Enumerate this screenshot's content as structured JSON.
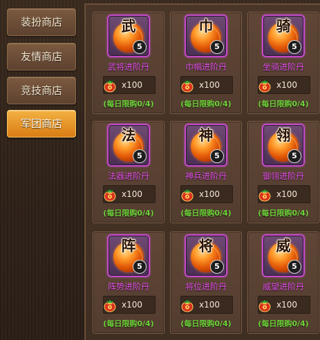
{
  "tabs": [
    {
      "label": "装扮商店",
      "active": false
    },
    {
      "label": "友情商店",
      "active": false
    },
    {
      "label": "竞技商店",
      "active": false
    },
    {
      "label": "军团商店",
      "active": true
    }
  ],
  "items": [
    {
      "glyph": "武",
      "name": "武将进阶丹",
      "count": "5",
      "price": "x100",
      "limit": "(每日限购0/4)"
    },
    {
      "glyph": "巾",
      "name": "巾帼进阶丹",
      "count": "5",
      "price": "x100",
      "limit": "(每日限购0/4)"
    },
    {
      "glyph": "骑",
      "name": "坐骑进阶丹",
      "count": "5",
      "price": "x100",
      "limit": "(每日限购0/4)"
    },
    {
      "glyph": "法",
      "name": "法器进阶丹",
      "count": "5",
      "price": "x100",
      "limit": "(每日限购0/4)"
    },
    {
      "glyph": "神",
      "name": "神兵进阶丹",
      "count": "5",
      "price": "x100",
      "limit": "(每日限购0/4)"
    },
    {
      "glyph": "翎",
      "name": "御翎进阶丹",
      "count": "5",
      "price": "x100",
      "limit": "(每日限购0/4)"
    },
    {
      "glyph": "阵",
      "name": "阵势进阶丹",
      "count": "5",
      "price": "x100",
      "limit": "(每日限购0/4)"
    },
    {
      "glyph": "将",
      "name": "将位进阶丹",
      "count": "5",
      "price": "x100",
      "limit": "(每日限购0/4)"
    },
    {
      "glyph": "威",
      "name": "威望进阶丹",
      "count": "5",
      "price": "x100",
      "limit": "(每日限购0/4)"
    }
  ],
  "icons": {
    "currency": "money-bag-icon",
    "item": "orange-orb-icon"
  },
  "colors": {
    "item_name": "#e24fe8",
    "limit_text": "#6fd23a",
    "active_tab": "#e98f22"
  }
}
